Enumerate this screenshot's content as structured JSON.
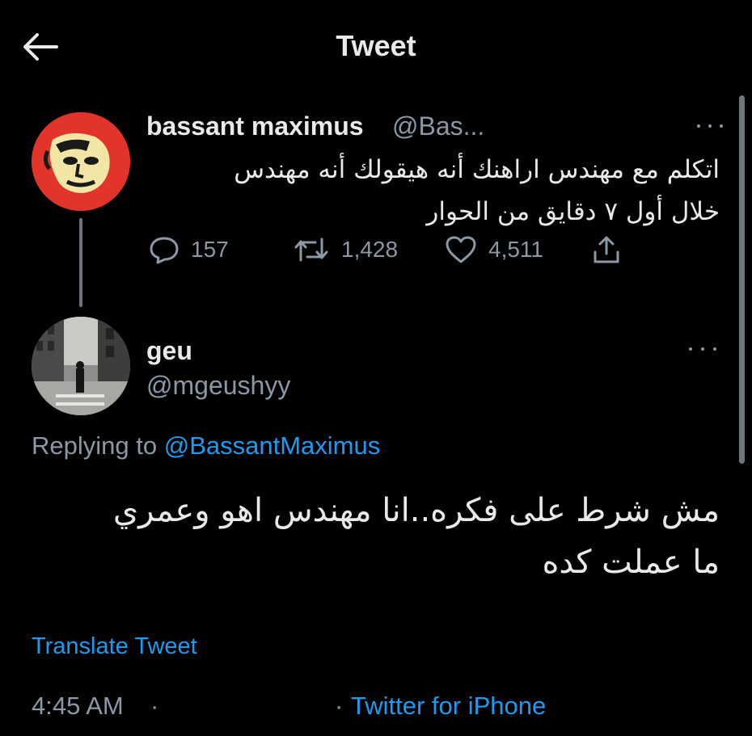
{
  "header": {
    "title": "Tweet",
    "back_icon": "arrow-left-icon"
  },
  "parent_tweet": {
    "name": "bassant maximus",
    "handle": "@Bas...",
    "avatar_color": "#e2342a",
    "text_line1": "اتكلم مع مهندس اراهنك أنه هيقولك أنه مهندس",
    "text_line2": "خلال أول ٧ دقايق من الحوار",
    "replies": "157",
    "retweets": "1,428",
    "likes": "4,511"
  },
  "reply_tweet": {
    "name": "geu",
    "handle": "@mgeushyy",
    "replying_prefix": "Replying to",
    "replying_to": "@BassantMaximus",
    "text_line1": "مش شرط على فكره..انا مهندس اهو وعمري",
    "text_line2": "ما عملت كده",
    "translate": "Translate Tweet",
    "time": "4:45 AM",
    "separator": "·",
    "source": "Twitter for iPhone"
  },
  "colors": {
    "background": "#000000",
    "primary_text": "#e7e9ea",
    "secondary_text": "#8b98a5",
    "accent": "#1d9bf0"
  }
}
